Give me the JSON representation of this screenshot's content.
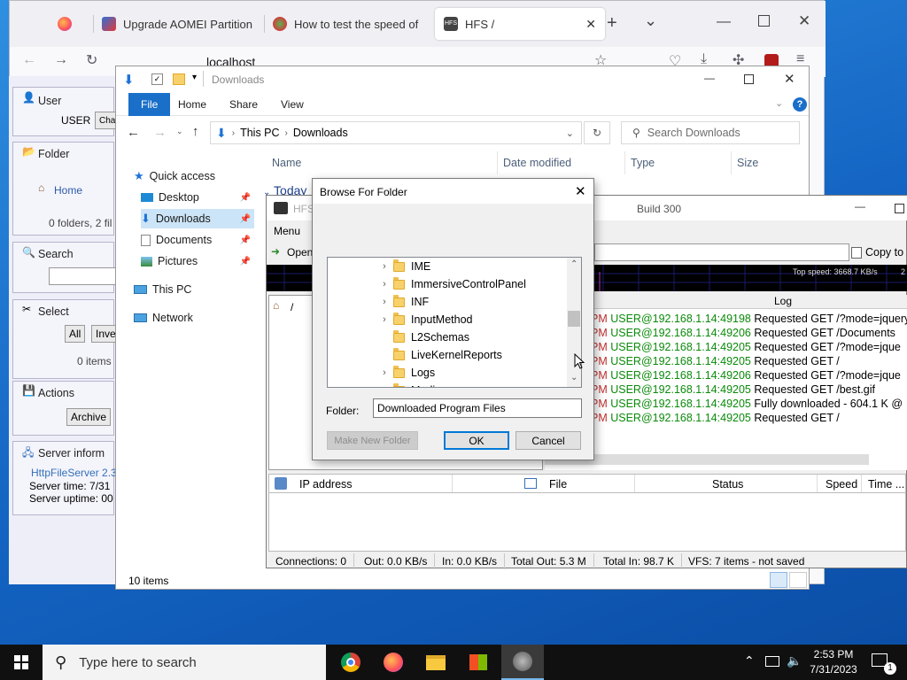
{
  "browser": {
    "tabs": [
      {
        "label": ""
      },
      {
        "label": "Upgrade AOMEI Partition"
      },
      {
        "label": "How to test the speed of"
      },
      {
        "label": "HFS /"
      }
    ],
    "new_tab": "+",
    "tab_list": "⌄",
    "url": "localhost"
  },
  "hfs_web": {
    "user_title": "User",
    "user_name": "USER",
    "change_btn": "Char",
    "folder_title": "Folder",
    "home_link": "Home",
    "folder_counts": "0 folders, 2 fil",
    "search_title": "Search",
    "select_title": "Select",
    "all_btn": "All",
    "invert_btn": "Inve",
    "items_count": "0 items",
    "actions_title": "Actions",
    "archive_btn": "Archive",
    "server_title": "Server inform",
    "server_link": "HttpFileServer 2.3",
    "server_time": "Server time: 7/31",
    "server_uptime": "Server uptime: 00"
  },
  "explorer": {
    "title": "Downloads",
    "ribbon": {
      "file": "File",
      "home": "Home",
      "share": "Share",
      "view": "View"
    },
    "address": {
      "this_pc": "This PC",
      "downloads": "Downloads"
    },
    "search_placeholder": "Search Downloads",
    "nav": {
      "quick_access": "Quick access",
      "desktop": "Desktop",
      "downloads": "Downloads",
      "documents": "Documents",
      "pictures": "Pictures",
      "this_pc": "This PC",
      "network": "Network"
    },
    "columns": {
      "name": "Name",
      "date": "Date modified",
      "type": "Type",
      "size": "Size"
    },
    "group": "Today",
    "status": "10 items"
  },
  "hfs_app": {
    "title": "HFS",
    "build": "Build 300",
    "menu": "Menu",
    "open": "Open",
    "copy_btn": "Copy to",
    "top_speed": "Top speed: 3668.7 KB/s",
    "top_speed_more": "2",
    "vfs_root": "/",
    "log_header": "Log",
    "log": [
      {
        "time": "PM",
        "ip": "USER@192.168.1.14:49198",
        "msg": "Requested GET /?mode=jquery"
      },
      {
        "time": "PM",
        "ip": "USER@192.168.1.14:49206",
        "msg": "Requested GET /Documents"
      },
      {
        "time": "PM",
        "ip": "USER@192.168.1.14:49205",
        "msg": "Requested GET /?mode=jque"
      },
      {
        "time": "PM",
        "ip": "USER@192.168.1.14:49205",
        "msg": "Requested GET /"
      },
      {
        "time": "PM",
        "ip": "USER@192.168.1.14:49206",
        "msg": "Requested GET /?mode=jque"
      },
      {
        "time": "PM",
        "ip": "USER@192.168.1.14:49205",
        "msg": "Requested GET /best.gif"
      },
      {
        "time": "PM",
        "ip": "USER@192.168.1.14:49205",
        "msg": "Fully downloaded - 604.1 K @"
      },
      {
        "time": "PM",
        "ip": "USER@192.168.1.14:49205",
        "msg": "Requested GET /"
      }
    ],
    "conn_columns": {
      "ip": "IP address",
      "file": "File",
      "status": "Status",
      "speed": "Speed",
      "time": "Time ..."
    },
    "statusbar": {
      "connections": "Connections: 0",
      "out": "Out: 0.0 KB/s",
      "in": "In: 0.0 KB/s",
      "total_out": "Total Out: 5.3 M",
      "total_in": "Total In: 98.7 K",
      "vfs": "VFS: 7 items - not saved"
    }
  },
  "dialog": {
    "title": "Browse For Folder",
    "folders": [
      {
        "name": "IME",
        "expandable": true
      },
      {
        "name": "ImmersiveControlPanel",
        "expandable": true
      },
      {
        "name": "INF",
        "expandable": true
      },
      {
        "name": "InputMethod",
        "expandable": true
      },
      {
        "name": "L2Schemas",
        "expandable": false
      },
      {
        "name": "LiveKernelReports",
        "expandable": false
      },
      {
        "name": "Logs",
        "expandable": true
      },
      {
        "name": "Media",
        "expandable": false
      }
    ],
    "folder_label": "Folder:",
    "folder_value": "Downloaded Program Files",
    "make_new_folder": "Make New Folder",
    "ok": "OK",
    "cancel": "Cancel"
  },
  "taskbar": {
    "search_placeholder": "Type here to search",
    "time": "2:53 PM",
    "date": "7/31/2023",
    "notification_count": "1"
  }
}
